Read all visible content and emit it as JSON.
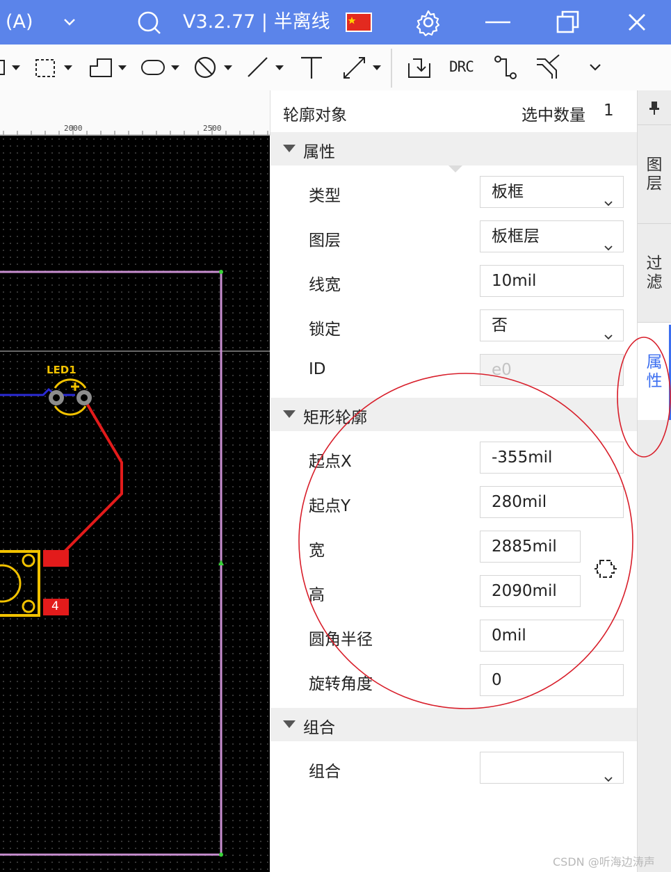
{
  "titlebar": {
    "edition": "(A)",
    "version": "V3.2.77 | 半离线",
    "icons": [
      "chevron-down-icon",
      "search-icon",
      "china-flag-icon",
      "gear-icon",
      "minimize-icon",
      "restore-icon",
      "close-icon"
    ]
  },
  "toolbar": {
    "drc_label": "DRC",
    "tools": [
      "board-outline-tool",
      "selection-tool",
      "polyline-tool",
      "oval-tool",
      "forbidden-area-tool",
      "line-tool",
      "text-tool",
      "dimension-tool",
      "import-changes-tool",
      "drc-tool",
      "route-tool",
      "differential-route-tool",
      "more-tools"
    ]
  },
  "ruler": {
    "ticks": [
      "2000",
      "2500"
    ]
  },
  "canvas": {
    "component_label": "LED1",
    "pad_number": "4",
    "colors": {
      "board_outline": "#c98fd1",
      "track": "#e31b1b",
      "silkscreen": "#f2c200",
      "pad": "#e31b1b",
      "background": "#000000"
    }
  },
  "panel": {
    "title": "轮廓对象",
    "selected_label": "选中数量",
    "selected_count": "1",
    "sections": {
      "properties": {
        "title": "属性",
        "rows": {
          "type": {
            "label": "类型",
            "value": "板框"
          },
          "layer": {
            "label": "图层",
            "value": "板框层"
          },
          "line_width": {
            "label": "线宽",
            "value": "10mil"
          },
          "lock": {
            "label": "锁定",
            "value": "否"
          },
          "id": {
            "label": "ID",
            "value": "e0"
          }
        }
      },
      "rect_outline": {
        "title": "矩形轮廓",
        "rows": {
          "start_x": {
            "label": "起点X",
            "value": "-355mil"
          },
          "start_y": {
            "label": "起点Y",
            "value": "280mil"
          },
          "width": {
            "label": "宽",
            "value": "2885mil"
          },
          "height": {
            "label": "高",
            "value": "2090mil"
          },
          "corner_radius": {
            "label": "圆角半径",
            "value": "0mil"
          },
          "rotation": {
            "label": "旋转角度",
            "value": "0"
          }
        }
      },
      "group": {
        "title": "组合",
        "rows": {
          "group": {
            "label": "组合",
            "value": ""
          }
        }
      }
    }
  },
  "sidetabs": {
    "layers": "图层",
    "filter": "过滤",
    "properties": "属性",
    "active": "properties",
    "accent": "#3b6ef0"
  },
  "annotation_color": "#d81e2a",
  "watermark": "CSDN @听海边涛声"
}
